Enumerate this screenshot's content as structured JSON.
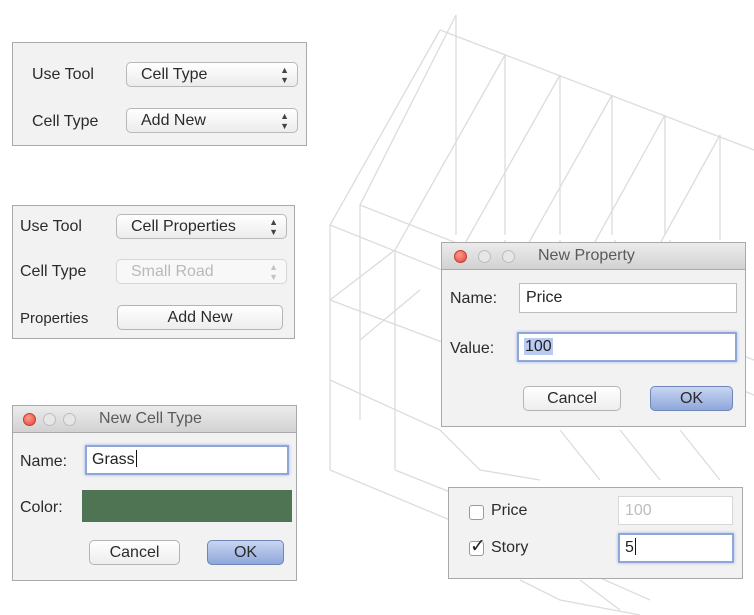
{
  "panel_a": {
    "use_tool_label": "Use Tool",
    "use_tool_value": "Cell Type",
    "cell_type_label": "Cell Type",
    "cell_type_value": "Add New"
  },
  "panel_b": {
    "use_tool_label": "Use Tool",
    "use_tool_value": "Cell Properties",
    "cell_type_label": "Cell Type",
    "cell_type_value": "Small Road",
    "properties_label": "Properties",
    "add_new_label": "Add New"
  },
  "new_cell_type_dialog": {
    "title": "New Cell Type",
    "name_label": "Name:",
    "name_value": "Grass",
    "color_label": "Color:",
    "color_value": "#4f7454",
    "cancel_label": "Cancel",
    "ok_label": "OK"
  },
  "new_property_dialog": {
    "title": "New Property",
    "name_label": "Name:",
    "name_value": "Price",
    "value_label": "Value:",
    "value_value": "100",
    "cancel_label": "Cancel",
    "ok_label": "OK"
  },
  "properties_list": {
    "rows": [
      {
        "label": "Price",
        "checked": false,
        "value": "100"
      },
      {
        "label": "Story",
        "checked": true,
        "value": "5"
      }
    ]
  },
  "icons": {
    "popup_arrows": "up-down-chevrons-icon",
    "checkmark": "checkmark-icon",
    "window_close": "close-traffic-light-icon"
  }
}
